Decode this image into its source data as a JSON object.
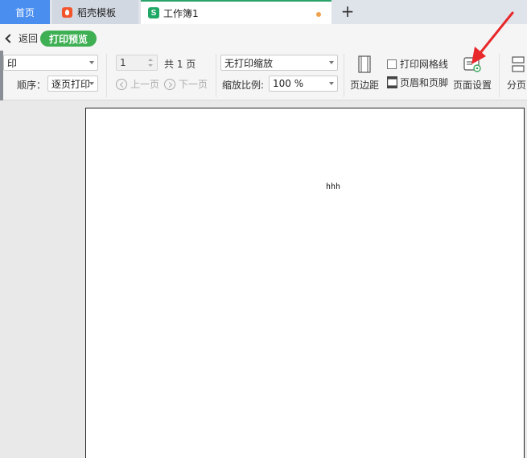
{
  "tabs": {
    "home": "首页",
    "template": "稻壳模板",
    "workbook": "工作簿1",
    "workbook_icon": "S",
    "new_tab": "+"
  },
  "backbar": {
    "back_label": "返回",
    "mode_badge": "打印预览"
  },
  "ribbon": {
    "printer_select_value": "印",
    "order_label": "顺序：",
    "order_value": "逐页打印",
    "page_number": "1",
    "page_total": "共 1 页",
    "prev_page": "上一页",
    "next_page": "下一页",
    "scaling_value": "无打印缩放",
    "zoom_label": "缩放比例:",
    "zoom_value": "100 %",
    "margins_label": "页边距",
    "gridlines_label": "打印网格线",
    "header_footer_label": "页眉和页脚",
    "page_setup_label": "页面设置",
    "page_break_label": "分页"
  },
  "sheet": {
    "cell_text": "hhh"
  },
  "colors": {
    "home_tab": "#4a8ef0",
    "badge_green": "#3eaf53",
    "workbook_icon": "#1fa864",
    "template_icon": "#f2552c",
    "unsaved_dot": "#f0a04b",
    "annotation_arrow": "#e8282a"
  }
}
